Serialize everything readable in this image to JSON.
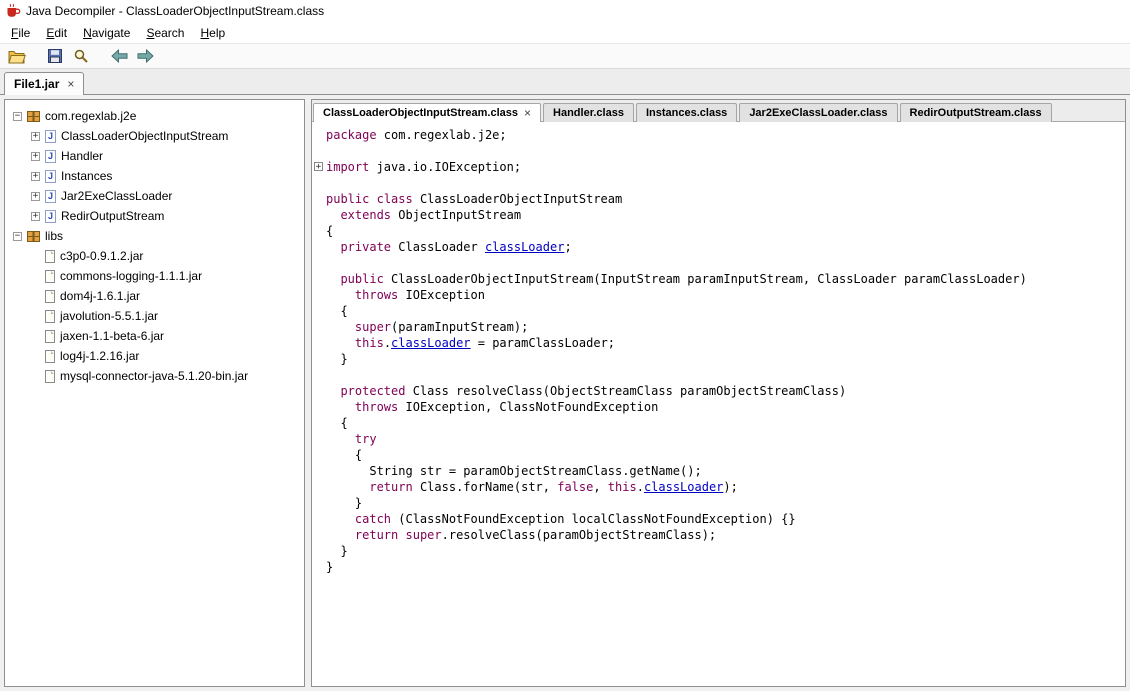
{
  "window": {
    "title": "Java Decompiler - ClassLoaderObjectInputStream.class",
    "app_icon": "java-decompiler-cup-icon"
  },
  "colors": {
    "keyword": "#7f0055",
    "field": "#0000c0"
  },
  "menu": {
    "items": [
      {
        "label": "File"
      },
      {
        "label": "Edit"
      },
      {
        "label": "Navigate"
      },
      {
        "label": "Search"
      },
      {
        "label": "Help"
      }
    ]
  },
  "toolbar": {
    "icons": [
      "open-folder-icon",
      "save-all-icon",
      "search-icon",
      "back-arrow-icon",
      "forward-arrow-icon"
    ]
  },
  "jar_tab": {
    "label": "File1.jar",
    "close_glyph": "×"
  },
  "tree": {
    "toggle_glyphs": {
      "plus": "+",
      "minus": "−"
    },
    "items": [
      {
        "label": "com.regexlab.j2e",
        "depth": 0,
        "toggle": "minus",
        "icon": "package"
      },
      {
        "label": "ClassLoaderObjectInputStream",
        "depth": 1,
        "toggle": "plus",
        "icon": "class"
      },
      {
        "label": "Handler",
        "depth": 1,
        "toggle": "plus",
        "icon": "class"
      },
      {
        "label": "Instances",
        "depth": 1,
        "toggle": "plus",
        "icon": "class"
      },
      {
        "label": "Jar2ExeClassLoader",
        "depth": 1,
        "toggle": "plus",
        "icon": "class"
      },
      {
        "label": "RedirOutputStream",
        "depth": 1,
        "toggle": "plus",
        "icon": "class"
      },
      {
        "label": "libs",
        "depth": 0,
        "toggle": "minus",
        "icon": "package"
      },
      {
        "label": "c3p0-0.9.1.2.jar",
        "depth": 1,
        "toggle": "none",
        "icon": "jar"
      },
      {
        "label": "commons-logging-1.1.1.jar",
        "depth": 1,
        "toggle": "none",
        "icon": "jar"
      },
      {
        "label": "dom4j-1.6.1.jar",
        "depth": 1,
        "toggle": "none",
        "icon": "jar"
      },
      {
        "label": "javolution-5.5.1.jar",
        "depth": 1,
        "toggle": "none",
        "icon": "jar"
      },
      {
        "label": "jaxen-1.1-beta-6.jar",
        "depth": 1,
        "toggle": "none",
        "icon": "jar"
      },
      {
        "label": "log4j-1.2.16.jar",
        "depth": 1,
        "toggle": "none",
        "icon": "jar"
      },
      {
        "label": "mysql-connector-java-5.1.20-bin.jar",
        "depth": 1,
        "toggle": "none",
        "icon": "jar"
      }
    ]
  },
  "editor": {
    "close_glyph": "×",
    "tabs": [
      {
        "label": "ClassLoaderObjectInputStream.class",
        "active": true,
        "closable": true
      },
      {
        "label": "Handler.class",
        "active": false,
        "closable": false
      },
      {
        "label": "Instances.class",
        "active": false,
        "closable": false
      },
      {
        "label": "Jar2ExeClassLoader.class",
        "active": false,
        "closable": false
      },
      {
        "label": "RedirOutputStream.class",
        "active": false,
        "closable": false
      }
    ],
    "code": {
      "fold_marker_glyph": "+",
      "fold_line_index": 2,
      "lines": [
        [
          [
            "k",
            "package"
          ],
          [
            "p",
            " com.regexlab.j2e;"
          ]
        ],
        [],
        [
          [
            "k",
            "import"
          ],
          [
            "p",
            " java.io.IOException;"
          ]
        ],
        [],
        [
          [
            "k",
            "public"
          ],
          [
            "p",
            " "
          ],
          [
            "k",
            "class"
          ],
          [
            "p",
            " ClassLoaderObjectInputStream"
          ]
        ],
        [
          [
            "p",
            "  "
          ],
          [
            "k",
            "extends"
          ],
          [
            "p",
            " ObjectInputStream"
          ]
        ],
        [
          [
            "p",
            "{"
          ]
        ],
        [
          [
            "p",
            "  "
          ],
          [
            "k",
            "private"
          ],
          [
            "p",
            " ClassLoader "
          ],
          [
            "f",
            "classLoader"
          ],
          [
            "p",
            ";"
          ]
        ],
        [],
        [
          [
            "p",
            "  "
          ],
          [
            "k",
            "public"
          ],
          [
            "p",
            " ClassLoaderObjectInputStream(InputStream paramInputStream, ClassLoader paramClassLoader)"
          ]
        ],
        [
          [
            "p",
            "    "
          ],
          [
            "k",
            "throws"
          ],
          [
            "p",
            " IOException"
          ]
        ],
        [
          [
            "p",
            "  {"
          ]
        ],
        [
          [
            "p",
            "    "
          ],
          [
            "k",
            "super"
          ],
          [
            "p",
            "(paramInputStream);"
          ]
        ],
        [
          [
            "p",
            "    "
          ],
          [
            "k",
            "this"
          ],
          [
            "p",
            "."
          ],
          [
            "f",
            "classLoader"
          ],
          [
            "p",
            " = paramClassLoader;"
          ]
        ],
        [
          [
            "p",
            "  }"
          ]
        ],
        [],
        [
          [
            "p",
            "  "
          ],
          [
            "k",
            "protected"
          ],
          [
            "p",
            " Class resolveClass(ObjectStreamClass paramObjectStreamClass)"
          ]
        ],
        [
          [
            "p",
            "    "
          ],
          [
            "k",
            "throws"
          ],
          [
            "p",
            " IOException, ClassNotFoundException"
          ]
        ],
        [
          [
            "p",
            "  {"
          ]
        ],
        [
          [
            "p",
            "    "
          ],
          [
            "k",
            "try"
          ]
        ],
        [
          [
            "p",
            "    {"
          ]
        ],
        [
          [
            "p",
            "      String str = paramObjectStreamClass.getName();"
          ]
        ],
        [
          [
            "p",
            "      "
          ],
          [
            "k",
            "return"
          ],
          [
            "p",
            " Class.forName(str, "
          ],
          [
            "k",
            "false"
          ],
          [
            "p",
            ", "
          ],
          [
            "k",
            "this"
          ],
          [
            "p",
            "."
          ],
          [
            "f",
            "classLoader"
          ],
          [
            "p",
            ");"
          ]
        ],
        [
          [
            "p",
            "    }"
          ]
        ],
        [
          [
            "p",
            "    "
          ],
          [
            "k",
            "catch"
          ],
          [
            "p",
            " (ClassNotFoundException localClassNotFoundException) {}"
          ]
        ],
        [
          [
            "p",
            "    "
          ],
          [
            "k",
            "return"
          ],
          [
            "p",
            " "
          ],
          [
            "k",
            "super"
          ],
          [
            "p",
            ".resolveClass(paramObjectStreamClass);"
          ]
        ],
        [
          [
            "p",
            "  }"
          ]
        ],
        [
          [
            "p",
            "}"
          ]
        ]
      ]
    }
  }
}
